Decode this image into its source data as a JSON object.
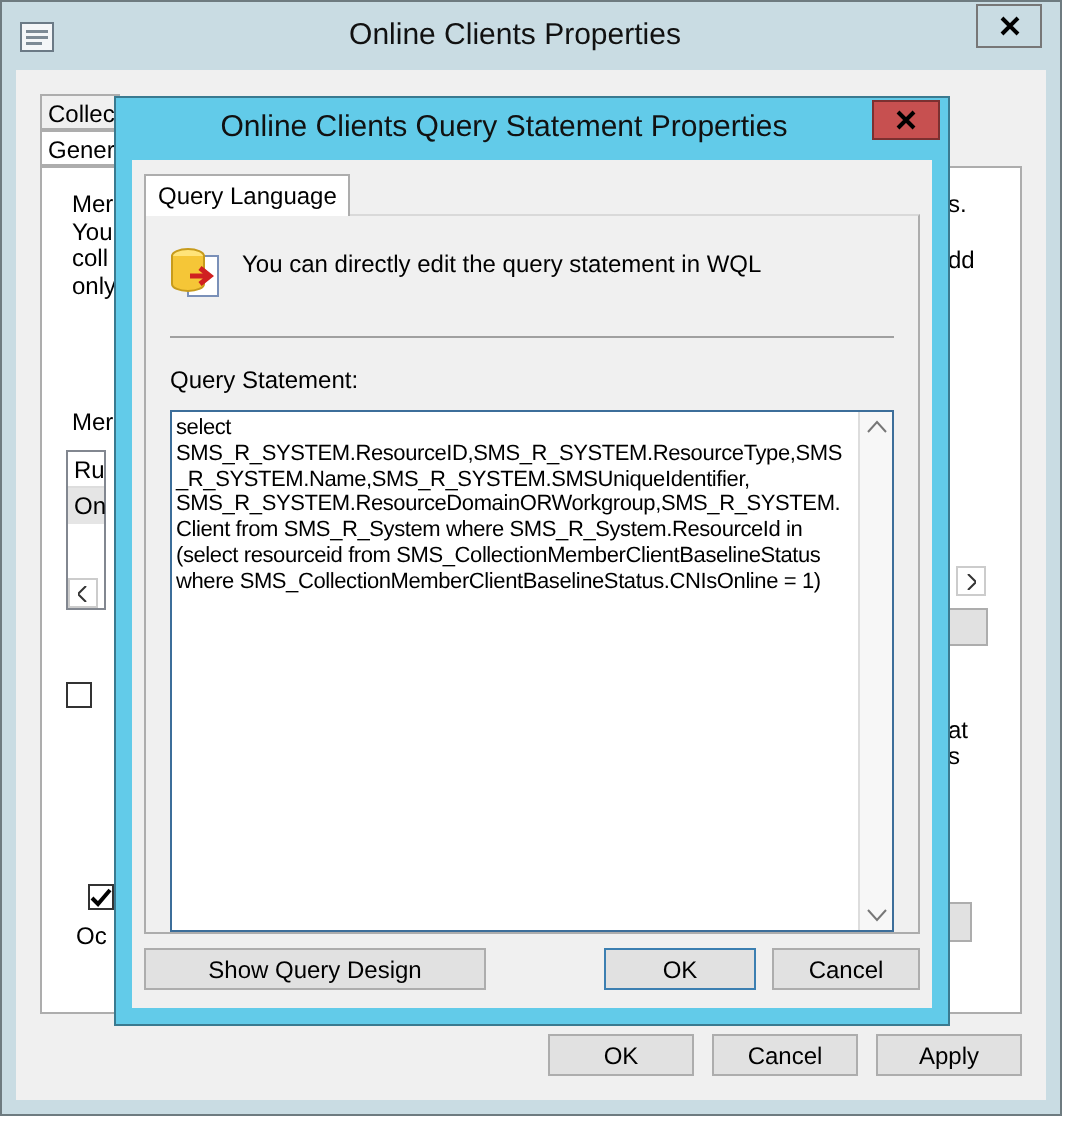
{
  "parent_window": {
    "title": "Online Clients Properties",
    "tabs": [
      {
        "label": "Collec",
        "selected": false
      },
      {
        "label": "Gener",
        "selected": true
      }
    ],
    "description_lines": [
      "Mer",
      "You",
      "coll",
      "only"
    ],
    "description_right": [
      "s.",
      "dd"
    ],
    "membership_label": "Mer",
    "rules_list": {
      "header": "Ru",
      "rows": [
        {
          "text": "On",
          "selected": true
        }
      ]
    },
    "checkbox_1": {
      "checked": false
    },
    "right_note": [
      "at",
      "s"
    ],
    "checkbox_2": {
      "checked": true
    },
    "group_label": "Oc",
    "buttons": [
      "OK",
      "Cancel",
      "Apply"
    ]
  },
  "dialog": {
    "title": "Online Clients Query Statement Properties",
    "tabs": [
      {
        "label": "Query Language",
        "selected": true
      }
    ],
    "info": "You can directly edit the query statement in WQL",
    "statement_label": "Query Statement:",
    "statement_lines": [
      "select",
      "SMS_R_SYSTEM.ResourceID,SMS_R_SYSTEM.ResourceType,SMS",
      "_R_SYSTEM.Name,SMS_R_SYSTEM.SMSUniqueIdentifier,",
      "SMS_R_SYSTEM.ResourceDomainORWorkgroup,SMS_R_SYSTEM.",
      "Client from SMS_R_System where SMS_R_System.ResourceId in",
      "(select resourceid from SMS_CollectionMemberClientBaselineStatus",
      "where SMS_CollectionMemberClientBaselineStatus.CNIsOnline = 1)"
    ],
    "buttons": [
      {
        "label": "Show Query Design",
        "default": false
      },
      {
        "label": "OK",
        "default": true
      },
      {
        "label": "Cancel",
        "default": false
      }
    ]
  }
}
